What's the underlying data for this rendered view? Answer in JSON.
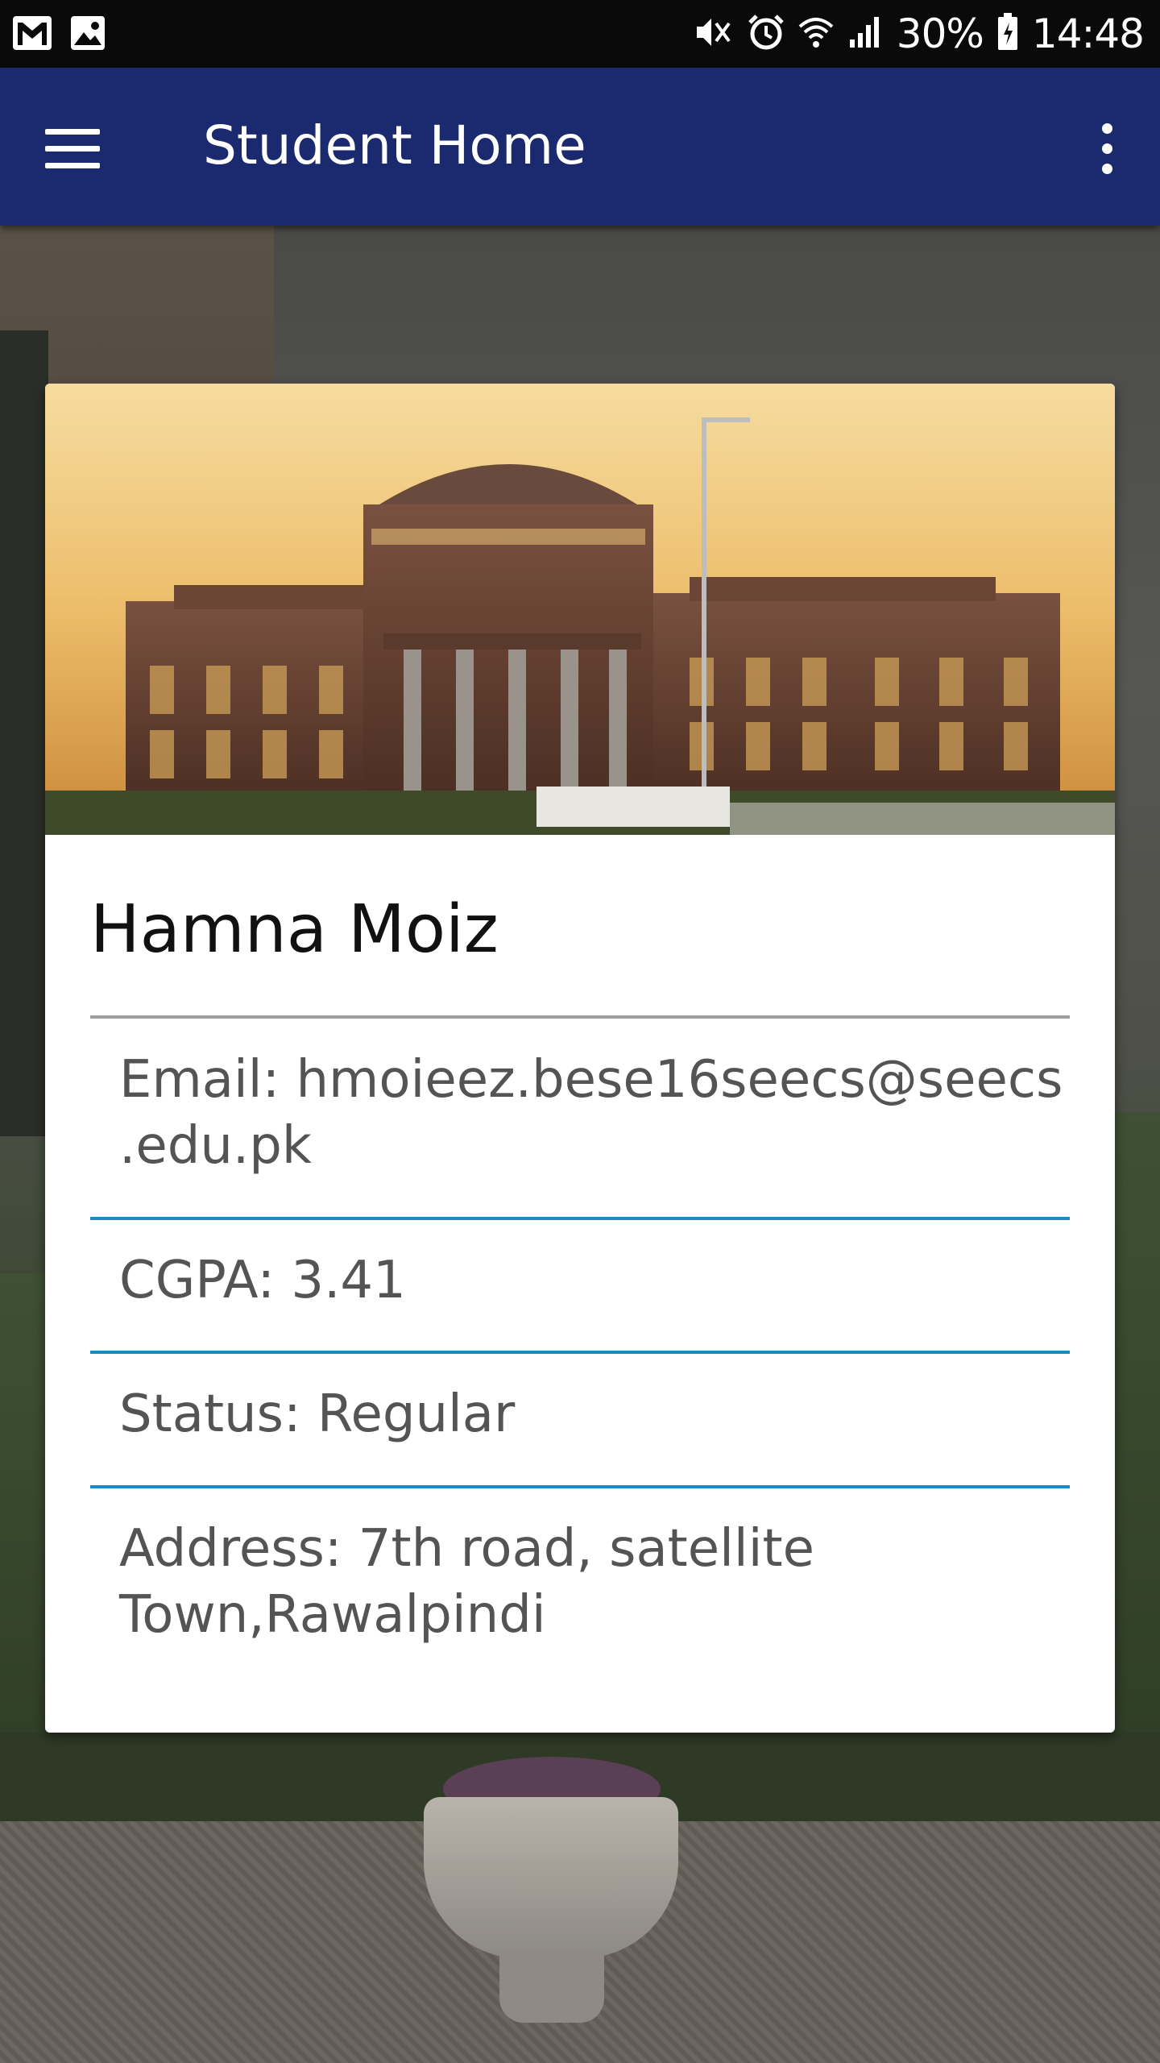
{
  "status_bar": {
    "icons_left": [
      "gmail-icon",
      "gallery-icon"
    ],
    "icons_right": [
      "mute-vibrate-icon",
      "alarm-icon",
      "wifi-icon",
      "signal-icon",
      "battery-icon"
    ],
    "battery_percent": "30%",
    "time": "14:48"
  },
  "app_bar": {
    "title": "Student Home",
    "color": "#1b2a6e",
    "menu_icon": "hamburger-menu-icon",
    "overflow_icon": "more-vertical-icon"
  },
  "card": {
    "image": "university-building-photo",
    "name": "Hamna Moiz",
    "rows": [
      {
        "text": "Email: hmoieez.bese16seecs@seecs .edu.pk",
        "line1": "Email: hmoieez.bese16seecs@seecs",
        "line2": ".edu.pk"
      },
      {
        "text": "CGPA: 3.41"
      },
      {
        "text": "Status: Regular"
      },
      {
        "text": "Address: 7th road, satellite Town,Rawalpindi",
        "line1": "Address: 7th road, satellite",
        "line2": "Town,Rawalpindi"
      }
    ],
    "divider_color": "#1e88c8"
  }
}
